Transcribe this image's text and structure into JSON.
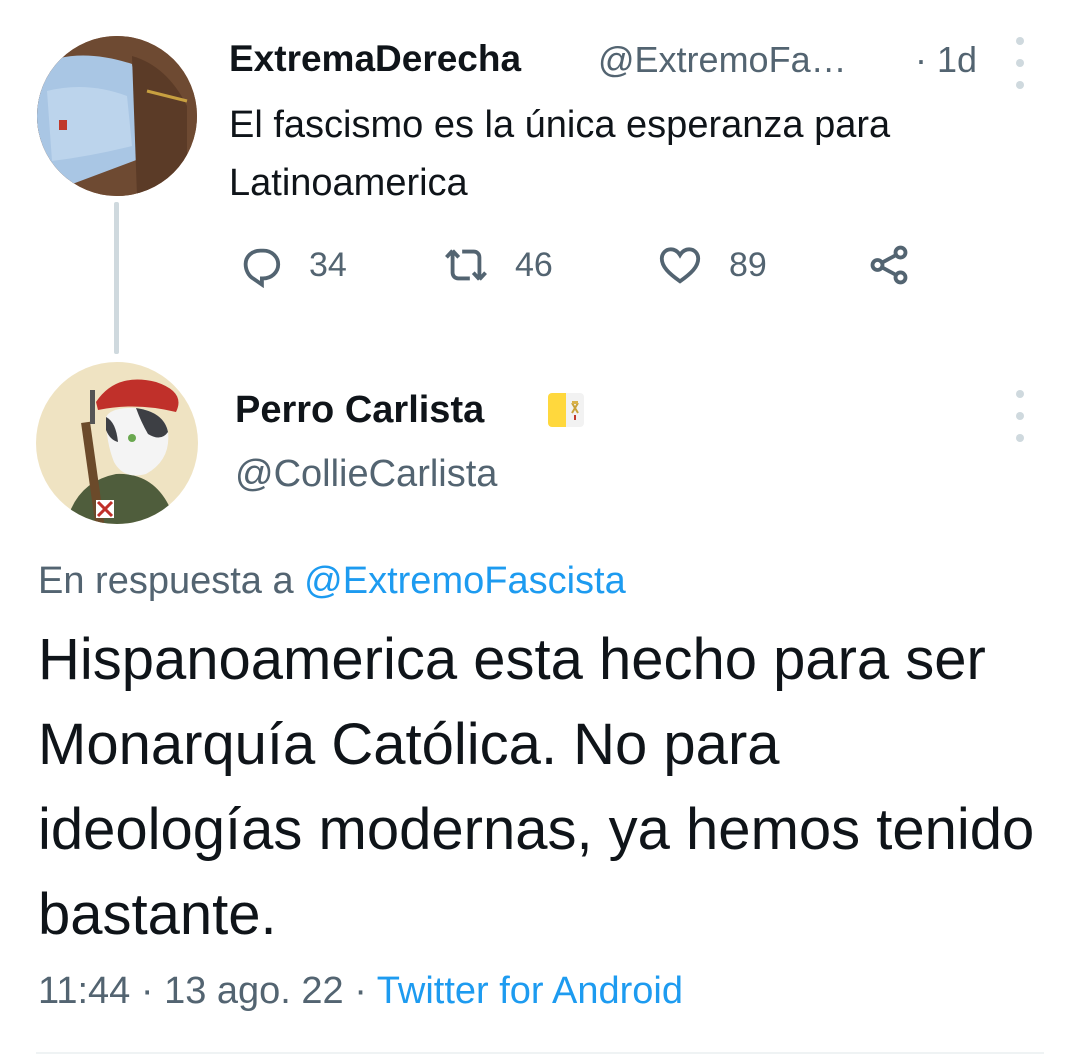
{
  "tweet1": {
    "display_name": "ExtremaDerecha",
    "handle": "@ExtremoFa…",
    "time": "· 1d",
    "text": "El fascismo es la única esperanza para Latinoamerica",
    "replies": "34",
    "retweets": "46",
    "likes": "89"
  },
  "tweet2": {
    "display_name": "Perro Carlista",
    "handle": "@CollieCarlista",
    "replying_prefix": "En respuesta a ",
    "replying_to": "@ExtremoFascista",
    "text": "Hispanoamerica esta hecho para ser Monarquía Católica. No para ideologías modernas, ya hemos tenido bastante.",
    "time": "11:44",
    "sep1": " · ",
    "date": "13 ago. 22",
    "sep2": " · ",
    "source": "Twitter for Android"
  },
  "icons": [
    "reply-icon",
    "retweet-icon",
    "like-icon",
    "share-icon",
    "more-icon",
    "vatican-flag-icon"
  ],
  "colors": {
    "link": "#1d9bf0",
    "secondary_text": "#536471",
    "primary_text": "#0f1419",
    "thread_line": "#cfd9de"
  }
}
